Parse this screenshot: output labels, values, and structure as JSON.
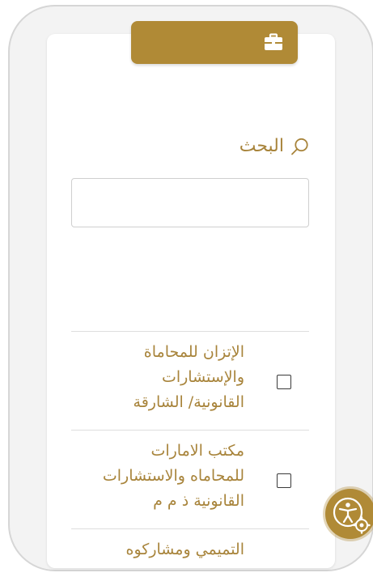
{
  "search": {
    "title": "البحث",
    "input_value": "",
    "placeholder": ""
  },
  "results": [
    {
      "name": "الإتزان للمحاماة\nوالإستشارات\nالقانونية/ الشارقة",
      "checked": false
    },
    {
      "name": "مكتب الامارات\nللمحاماه والاستشارات\nالقانونية ذ م م",
      "checked": false
    },
    {
      "name": "التميمي ومشاركوه",
      "checked": false
    }
  ],
  "colors": {
    "accent": "#b08a36",
    "text_gold": "#a8843b"
  },
  "icons": {
    "header": "briefcase-icon",
    "search": "search-icon",
    "accessibility": "accessibility-settings-icon"
  }
}
